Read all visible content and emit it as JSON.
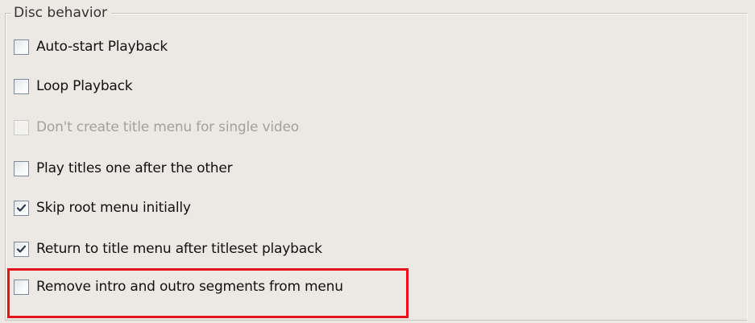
{
  "group": {
    "legend": "Disc behavior"
  },
  "options": [
    {
      "label": "Auto-start Playback",
      "checked": false,
      "enabled": true
    },
    {
      "label": "Loop Playback",
      "checked": false,
      "enabled": true
    },
    {
      "label": "Don't create title menu for single video",
      "checked": false,
      "enabled": false
    },
    {
      "label": "Play titles one after the other",
      "checked": false,
      "enabled": true
    },
    {
      "label": "Skip root menu initially",
      "checked": true,
      "enabled": true
    },
    {
      "label": "Return to title menu after titleset playback",
      "checked": true,
      "enabled": true
    },
    {
      "label": "Remove intro and outro segments from menu",
      "checked": false,
      "enabled": true
    }
  ],
  "colors": {
    "highlight": "#e4141c",
    "background": "#ece9e4",
    "disabled_text": "#a4a19b"
  },
  "icons": {
    "checkmark": "check-mark-icon"
  }
}
